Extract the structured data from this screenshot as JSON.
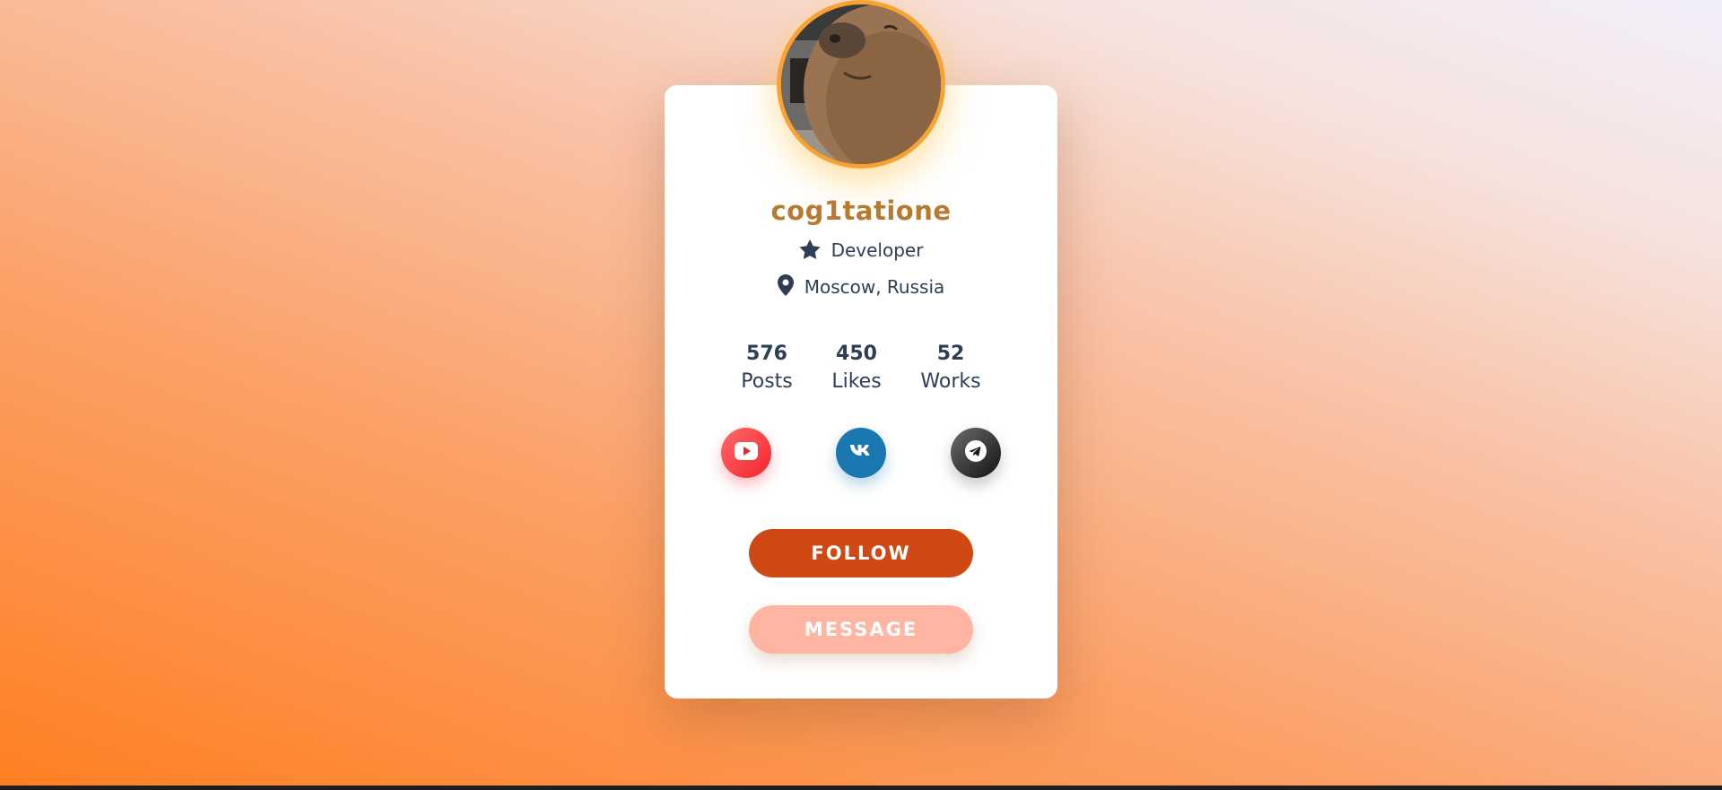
{
  "profile": {
    "username": "cog1tatione",
    "role": "Developer",
    "location": "Moscow, Russia",
    "avatar_icon": "capybara-photo"
  },
  "stats": [
    {
      "value": "576",
      "label": "Posts"
    },
    {
      "value": "450",
      "label": "Likes"
    },
    {
      "value": "52",
      "label": "Works"
    }
  ],
  "social": [
    {
      "icon": "youtube-icon",
      "color": "#f5232f"
    },
    {
      "icon": "vk-icon",
      "color": "#1a77b0"
    },
    {
      "icon": "telegram-icon",
      "color": "#111111"
    }
  ],
  "actions": {
    "follow_label": "FOLLOW",
    "message_label": "MESSAGE"
  },
  "colors": {
    "accent_username": "#b87a2e",
    "follow_button": "#d04813",
    "message_button": "#ffb5a2",
    "avatar_ring": "#f8a234",
    "text": "#2e3f55"
  }
}
